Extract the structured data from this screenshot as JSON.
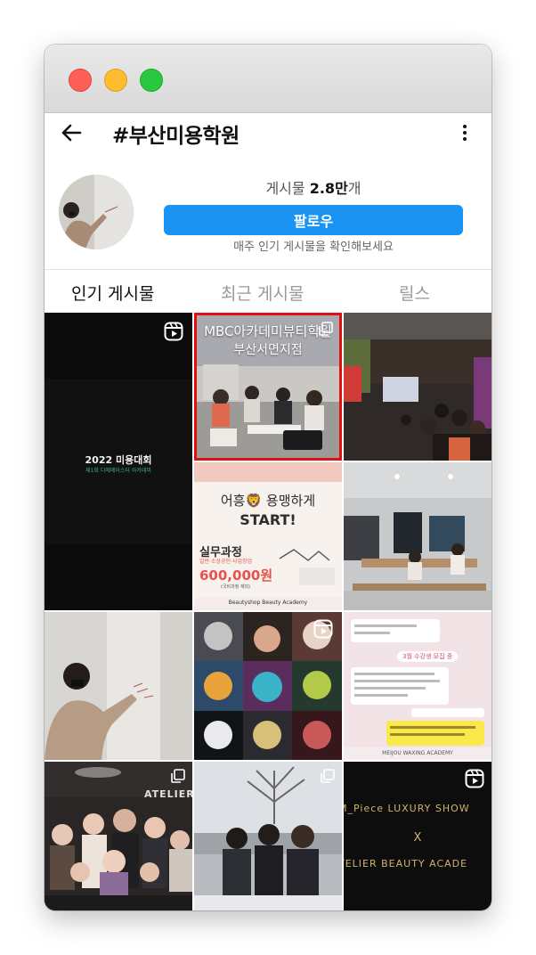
{
  "header": {
    "title": "#부산미용학원"
  },
  "profile": {
    "posts_label": "게시물",
    "posts_count": "2.8만",
    "posts_suffix": "개",
    "follow_label": "팔로우",
    "hint": "매주 인기 게시물을 확인해보세요"
  },
  "tabs": [
    {
      "label": "인기 게시물",
      "active": true
    },
    {
      "label": "최근 게시물",
      "active": false
    },
    {
      "label": "릴스",
      "active": false
    }
  ],
  "posts": {
    "p1": {
      "title": "2022 미용대회",
      "subtitle": "제1회 디에메이스터 아카데미"
    },
    "p2": {
      "line1": "MBC아카데미뷰티학원",
      "line2": "부산서면지점"
    },
    "p4": {
      "headline1": "어흥🦁 용맹하게",
      "headline2": "START!",
      "course": "실무과정",
      "course_sub": "일반·소상공인·사업창업",
      "price": "600,000원",
      "price_sub": "(국비과정 제외)",
      "brand": "Beautyshop Beauty Academy"
    },
    "p9": {
      "banner": "3월 수강생 모집 중",
      "footer": "MEIJOU WAXING ACADEMY"
    },
    "p10": {
      "sign": "ATELIER"
    },
    "p12": {
      "line1": "M_Piece LUXURY SHOW",
      "x": "X",
      "line2": "TELIER BEAUTY ACADE"
    }
  },
  "colors": {
    "follow": "#1a93f3",
    "highlight": "#e01010",
    "price": "#e8524a",
    "gold": "#c8a65a"
  }
}
